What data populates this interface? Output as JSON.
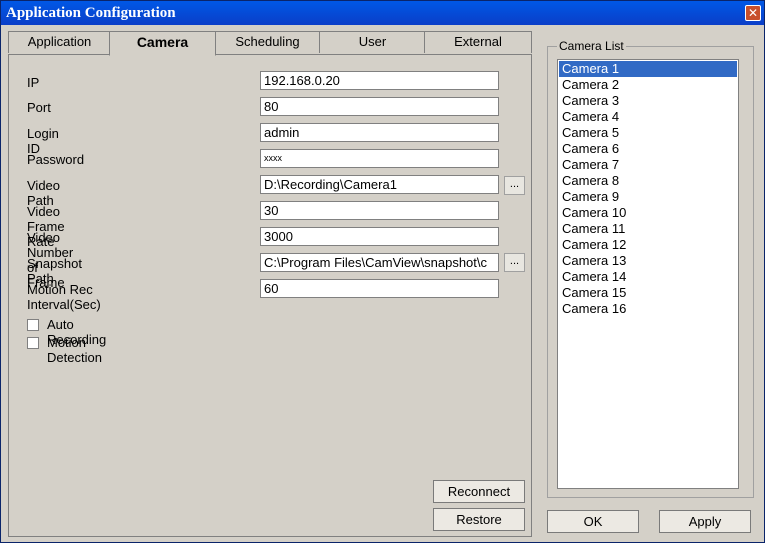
{
  "window": {
    "title": "Application Configuration",
    "close_glyph": "✕"
  },
  "tabs": [
    {
      "label": "Application",
      "active": false
    },
    {
      "label": "Camera",
      "active": true
    },
    {
      "label": "Scheduling",
      "active": false
    },
    {
      "label": "User",
      "active": false
    },
    {
      "label": "External",
      "active": false
    }
  ],
  "form": {
    "ip": {
      "label": "IP",
      "value": "192.168.0.20"
    },
    "port": {
      "label": "Port",
      "value": "80"
    },
    "login_id": {
      "label": "Login ID",
      "value": "admin"
    },
    "password": {
      "label": "Password",
      "value": "xxxx"
    },
    "video_path": {
      "label": "Video Path",
      "value": "D:\\Recording\\Camera1",
      "browse": "..."
    },
    "video_frame_rate": {
      "label": "Video Frame Rate",
      "value": "30"
    },
    "video_number_of_frame": {
      "label": "Video Number of Frame",
      "value": "3000"
    },
    "snapshot_path": {
      "label": "Snapshot Path",
      "value": "C:\\Program Files\\CamView\\snapshot\\c",
      "browse": "..."
    },
    "motion_rec_interval": {
      "label": "Motion Rec Interval(Sec)",
      "value": "60"
    }
  },
  "checkboxes": {
    "auto_recording": {
      "label": "Auto Recording",
      "checked": false
    },
    "motion_detection": {
      "label": "Motion Detection",
      "checked": false
    }
  },
  "buttons": {
    "reconnect": "Reconnect",
    "restore": "Restore",
    "ok": "OK",
    "apply": "Apply"
  },
  "camera_list": {
    "title": "Camera List",
    "selected": "Camera 1",
    "items": [
      "Camera 1",
      "Camera 2",
      "Camera 3",
      "Camera 4",
      "Camera 5",
      "Camera 6",
      "Camera 7",
      "Camera 8",
      "Camera 9",
      "Camera 10",
      "Camera 11",
      "Camera 12",
      "Camera 13",
      "Camera 14",
      "Camera 15",
      "Camera 16"
    ]
  },
  "colors": {
    "titlebar": "#0a3ec8",
    "selection": "#316ac5",
    "dialog_bg": "#d4d0c8"
  }
}
